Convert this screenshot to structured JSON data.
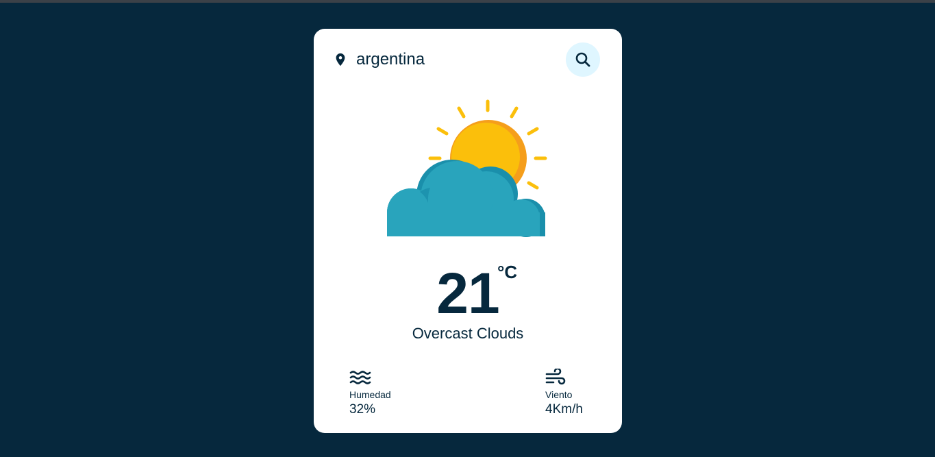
{
  "search": {
    "value": "argentina",
    "location_icon": "map-pin-icon",
    "button_icon": "search-icon"
  },
  "weather": {
    "image_icon": "sun-behind-cloud-icon",
    "temperature": "21",
    "unit": "°C",
    "description": "Overcast Clouds"
  },
  "details": {
    "humidity": {
      "icon": "water-waves-icon",
      "label": "Humedad",
      "value": "32%"
    },
    "wind": {
      "icon": "wind-icon",
      "label": "Viento",
      "value": "4Km/h"
    }
  },
  "colors": {
    "background": "#06283d",
    "card": "#ffffff",
    "text": "#06283d",
    "search_button_bg": "#dff6ff",
    "sun": "#fbbf0b",
    "sun_shade": "#f59e1b",
    "cloud": "#29a4bc",
    "cloud_shade": "#1a8fab"
  }
}
